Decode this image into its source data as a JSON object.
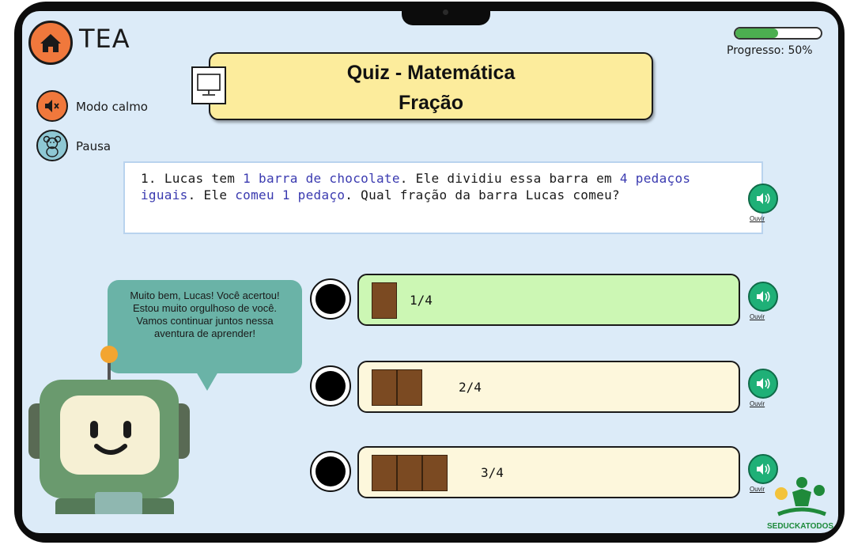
{
  "app": {
    "title": "TEA",
    "home_icon": "home-icon"
  },
  "controls": {
    "calm_label": "Modo calmo",
    "calm_icon": "muted-speaker-icon",
    "pause_label": "Pausa",
    "pause_icon": "teddy-bear-icon"
  },
  "progress": {
    "label": "Progresso: 50%",
    "value": 0.5,
    "color": "#4caf50"
  },
  "quiz": {
    "title_line1": "Quiz - Matemática",
    "title_line2": "Fração",
    "title_icon": "monitor-icon"
  },
  "question": {
    "number": "1.",
    "p1": "Lucas tem ",
    "h1": "1 barra de chocolate",
    "p2": ". Ele dividiu essa barra em ",
    "h2": "4 pedaços iguais",
    "p3": ". Ele ",
    "h3": "comeu 1 pedaço",
    "p4": ". Qual fração da barra Lucas comeu?",
    "highlight_color": "#3a3ab0"
  },
  "listen_label": "Ouvir",
  "options": [
    {
      "label": "1/4",
      "pieces": 1,
      "state": "correct"
    },
    {
      "label": "2/4",
      "pieces": 2,
      "state": "normal"
    },
    {
      "label": "3/4",
      "pieces": 3,
      "state": "normal"
    }
  ],
  "mascot": {
    "message": "Muito bem, Lucas! Você acertou! Estou muito orgulhoso de você. Vamos continuar juntos nessa aventura de aprender!",
    "icon": "robot-mascot"
  },
  "logo": {
    "text": "SEDUCKATODOS"
  },
  "colors": {
    "screen_bg": "#dcebf8",
    "accent_orange": "#f0783c",
    "title_bg": "#fcec9c",
    "correct_bg": "#ccf7b4",
    "option_bg": "#fdf7dc",
    "listen_green": "#1fb077"
  }
}
